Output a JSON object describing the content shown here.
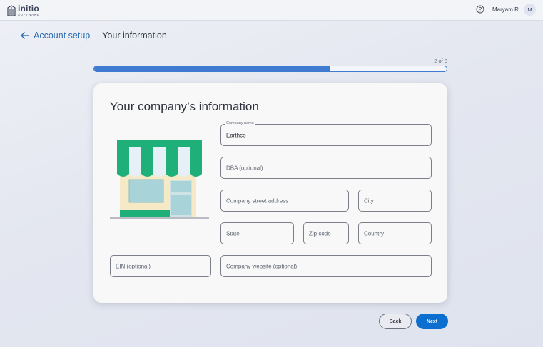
{
  "header": {
    "logo": {
      "name": "initio",
      "sub": "SOFTWARE"
    },
    "help_icon": "help-circle-icon",
    "user_name": "Maryam R.",
    "avatar_initial": "M"
  },
  "breadcrumb": {
    "back_label": "Account setup",
    "current": "Your information"
  },
  "progress": {
    "step_text": "2 of 3",
    "value": 0.67,
    "color": "#3f7bd0"
  },
  "form": {
    "title": "Your company’s information",
    "illustration": "storefront-illustration",
    "company_name": {
      "label": "Company name",
      "value": "Earthco"
    },
    "dba": {
      "placeholder": "DBA (optional)"
    },
    "street": {
      "placeholder": "Company street address"
    },
    "city": {
      "placeholder": "City"
    },
    "state": {
      "placeholder": "State"
    },
    "zip": {
      "placeholder": "Zip code"
    },
    "country": {
      "placeholder": "Country"
    },
    "ein": {
      "placeholder": "EIN (optional)"
    },
    "website": {
      "placeholder": "Company website (optional)"
    }
  },
  "actions": {
    "back_label": "Back",
    "next_label": "Next"
  },
  "colors": {
    "primary": "#0c6fd0",
    "link": "#2b6cb0",
    "awning_green": "#1fb07a"
  }
}
